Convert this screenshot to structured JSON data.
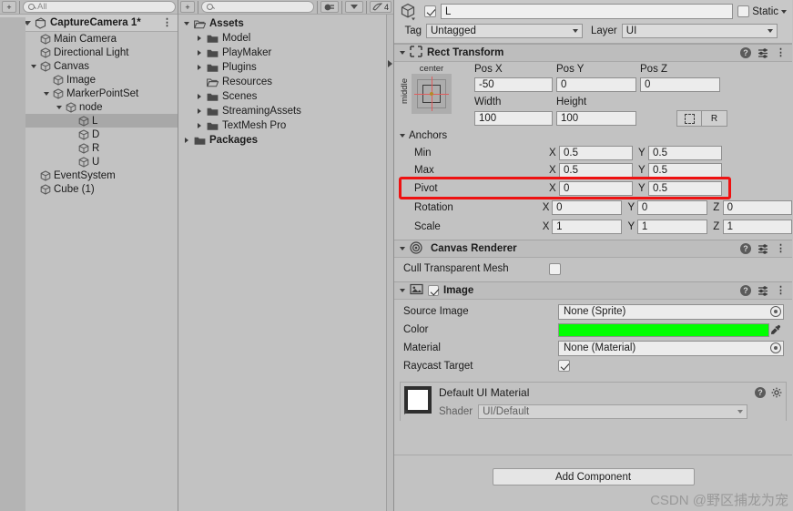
{
  "hierarchy": {
    "search_placeholder": "All",
    "scene_name": "CaptureCamera 1*",
    "menu_icon": "kebab-menu-icon",
    "items": [
      {
        "label": "Main Camera",
        "depth": 1,
        "expandable": false,
        "expanded": false,
        "selected": false
      },
      {
        "label": "Directional Light",
        "depth": 1,
        "expandable": false,
        "expanded": false,
        "selected": false
      },
      {
        "label": "Canvas",
        "depth": 1,
        "expandable": true,
        "expanded": true,
        "selected": false
      },
      {
        "label": "Image",
        "depth": 2,
        "expandable": false,
        "expanded": false,
        "selected": false
      },
      {
        "label": "MarkerPointSet",
        "depth": 2,
        "expandable": true,
        "expanded": true,
        "selected": false
      },
      {
        "label": "node",
        "depth": 3,
        "expandable": true,
        "expanded": true,
        "selected": false
      },
      {
        "label": "L",
        "depth": 4,
        "expandable": false,
        "expanded": false,
        "selected": true
      },
      {
        "label": "D",
        "depth": 4,
        "expandable": false,
        "expanded": false,
        "selected": false
      },
      {
        "label": "R",
        "depth": 4,
        "expandable": false,
        "expanded": false,
        "selected": false
      },
      {
        "label": "U",
        "depth": 4,
        "expandable": false,
        "expanded": false,
        "selected": false
      },
      {
        "label": "EventSystem",
        "depth": 1,
        "expandable": false,
        "expanded": false,
        "selected": false
      },
      {
        "label": "Cube (1)",
        "depth": 1,
        "expandable": false,
        "expanded": false,
        "selected": false
      }
    ]
  },
  "project": {
    "search_placeholder": "",
    "badge_count": "4",
    "items": [
      {
        "label": "Assets",
        "depth": 0,
        "expandable": true,
        "expanded": true,
        "bold": true,
        "open_folder": true
      },
      {
        "label": "Model",
        "depth": 1,
        "expandable": true,
        "expanded": false,
        "bold": false,
        "open_folder": false
      },
      {
        "label": "PlayMaker",
        "depth": 1,
        "expandable": true,
        "expanded": false,
        "bold": false,
        "open_folder": false
      },
      {
        "label": "Plugins",
        "depth": 1,
        "expandable": true,
        "expanded": false,
        "bold": false,
        "open_folder": false
      },
      {
        "label": "Resources",
        "depth": 1,
        "expandable": false,
        "expanded": false,
        "bold": false,
        "open_folder": true
      },
      {
        "label": "Scenes",
        "depth": 1,
        "expandable": true,
        "expanded": false,
        "bold": false,
        "open_folder": false
      },
      {
        "label": "StreamingAssets",
        "depth": 1,
        "expandable": true,
        "expanded": false,
        "bold": false,
        "open_folder": false
      },
      {
        "label": "TextMesh Pro",
        "depth": 1,
        "expandable": true,
        "expanded": false,
        "bold": false,
        "open_folder": false
      },
      {
        "label": "Packages",
        "depth": 0,
        "expandable": true,
        "expanded": false,
        "bold": true,
        "open_folder": false
      }
    ]
  },
  "inspector": {
    "object_name": "L",
    "object_enabled": true,
    "static_label": "Static",
    "static_checked": false,
    "tag_label": "Tag",
    "tag_value": "Untagged",
    "layer_label": "Layer",
    "layer_value": "UI",
    "rect_transform": {
      "title": "Rect Transform",
      "anchor_preset_top": "center",
      "anchor_preset_left": "middle",
      "pos_x_label": "Pos X",
      "pos_x": "-50",
      "pos_y_label": "Pos Y",
      "pos_y": "0",
      "pos_z_label": "Pos Z",
      "pos_z": "0",
      "width_label": "Width",
      "width": "100",
      "height_label": "Height",
      "height": "100",
      "blueprint_button": "blueprint-mode-icon",
      "raw_button": "R",
      "anchors_label": "Anchors",
      "min_label": "Min",
      "min_x": "0.5",
      "min_y": "0.5",
      "max_label": "Max",
      "max_x": "0.5",
      "max_y": "0.5",
      "pivot_label": "Pivot",
      "pivot_x": "0",
      "pivot_y": "0.5",
      "rotation_label": "Rotation",
      "rot_x": "0",
      "rot_y": "0",
      "rot_z": "0",
      "scale_label": "Scale",
      "scale_x": "1",
      "scale_y": "1",
      "scale_z": "1",
      "axis_x": "X",
      "axis_y": "Y",
      "axis_z": "Z"
    },
    "canvas_renderer": {
      "title": "Canvas Renderer",
      "cull_label": "Cull Transparent Mesh",
      "cull_checked": false
    },
    "image": {
      "title": "Image",
      "enabled": true,
      "source_image_label": "Source Image",
      "source_image_value": "None (Sprite)",
      "color_label": "Color",
      "color_value": "#00FF00",
      "material_label": "Material",
      "material_value": "None (Material)",
      "raycast_label": "Raycast Target",
      "raycast_checked": true
    },
    "material_block": {
      "title": "Default UI Material",
      "shader_label": "Shader",
      "shader_value": "UI/Default"
    },
    "add_component_label": "Add Component",
    "highlight_color": "#EE1111"
  },
  "watermark": "CSDN @野区捕龙为宠"
}
